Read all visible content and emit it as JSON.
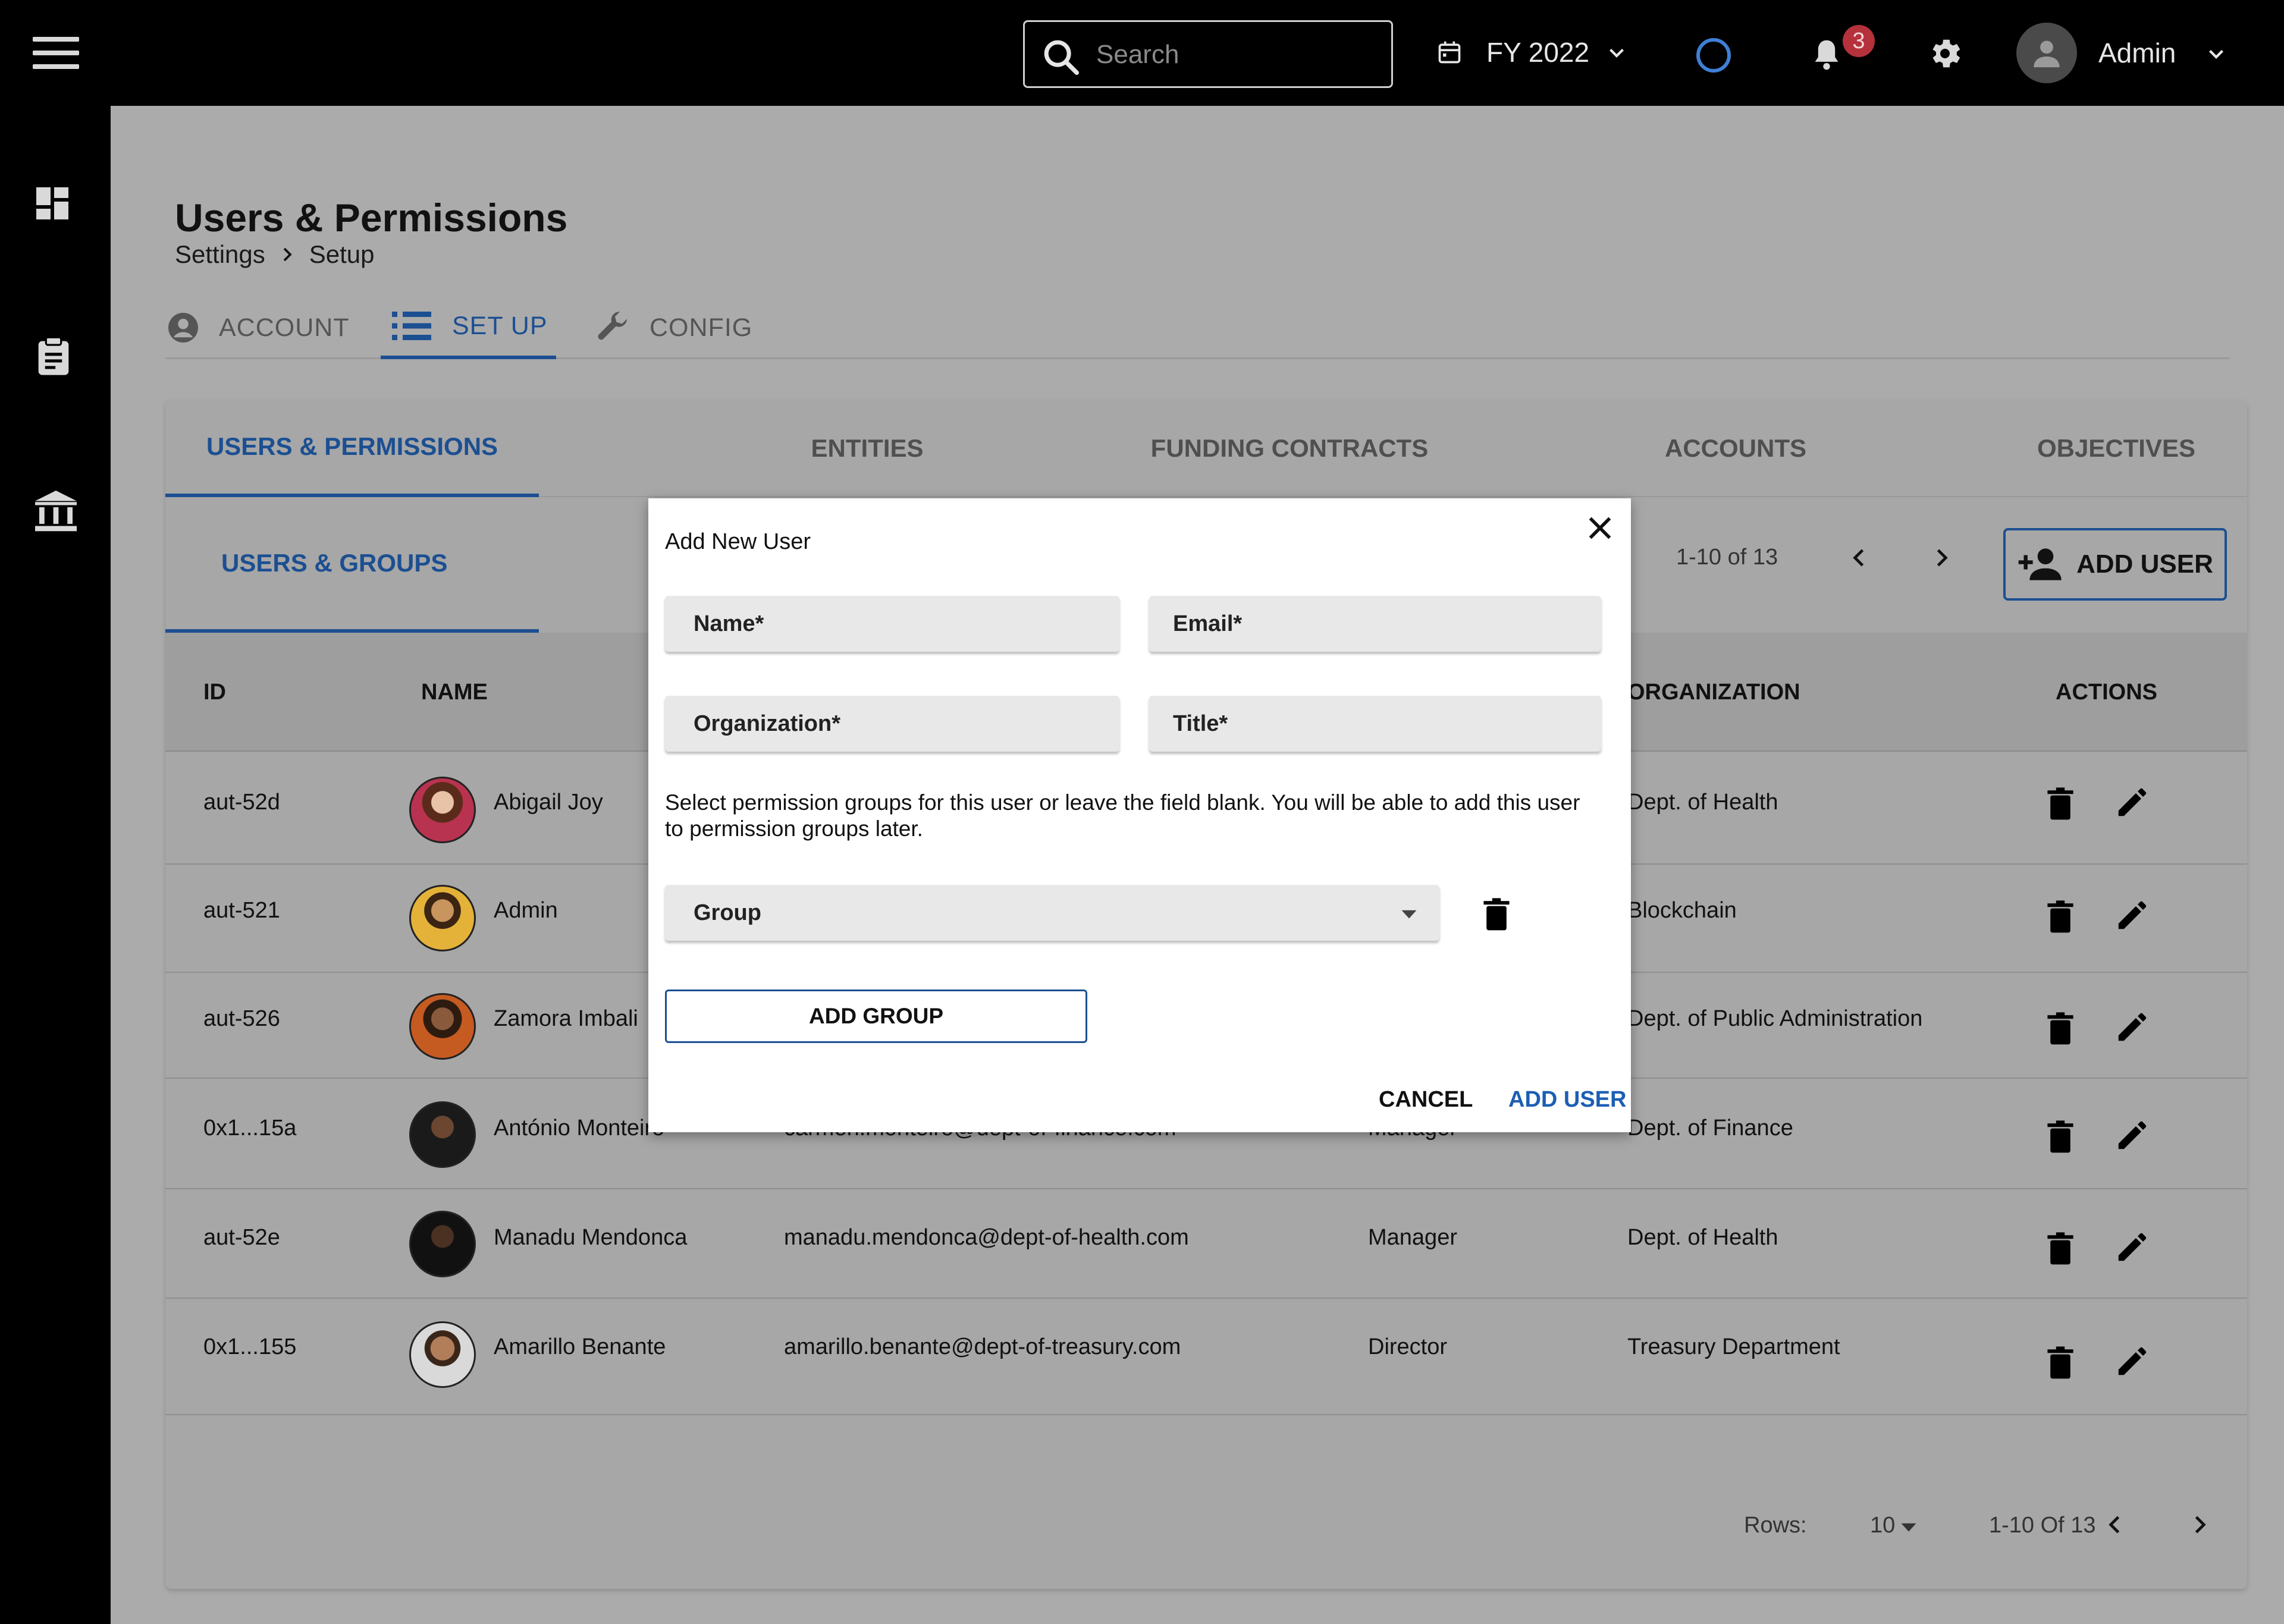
{
  "topbar": {
    "search_placeholder": "Search",
    "fiscal_year": "FY 2022",
    "notification_count": "3",
    "user_name": "Admin"
  },
  "page": {
    "title": "Users & Permissions",
    "breadcrumb": [
      "Settings",
      "Setup"
    ]
  },
  "main_tabs": [
    {
      "label": "ACCOUNT",
      "icon": "account-circle-icon",
      "active": false
    },
    {
      "label": "SET UP",
      "icon": "list-icon",
      "active": true
    },
    {
      "label": "CONFIG",
      "icon": "wrench-icon",
      "active": false
    }
  ],
  "section_tabs": [
    {
      "label": "USERS & PERMISSIONS",
      "active": true
    },
    {
      "label": "ENTITIES",
      "active": false
    },
    {
      "label": "FUNDING CONTRACTS",
      "active": false
    },
    {
      "label": "ACCOUNTS",
      "active": false
    },
    {
      "label": "OBJECTIVES",
      "active": false
    }
  ],
  "subtab": "USERS & GROUPS",
  "pagination_top": {
    "range": "1-10 of 13"
  },
  "add_user_label": "ADD USER",
  "table": {
    "columns": [
      "ID",
      "NAME",
      "ORGANIZATION",
      "ACTIONS"
    ],
    "rows": [
      {
        "id": "aut-52d",
        "name": "Abigail Joy",
        "email": "",
        "title": "",
        "organization": "Dept. of Health"
      },
      {
        "id": "aut-521",
        "name": "Admin",
        "email": "",
        "title": "",
        "organization": "Blockchain"
      },
      {
        "id": "aut-526",
        "name": "Zamora Imbali",
        "email": "",
        "title": "",
        "organization": "Dept. of Public Administration"
      },
      {
        "id": "0x1...15a",
        "name": "António Monteiro",
        "email": "carmen.monteiro@dept-of-finance.com",
        "title": "Manager",
        "organization": "Dept. of Finance"
      },
      {
        "id": "aut-52e",
        "name": "Manadu Mendonca",
        "email": "manadu.mendonca@dept-of-health.com",
        "title": "Manager",
        "organization": "Dept. of Health"
      },
      {
        "id": "0x1...155",
        "name": "Amarillo Benante",
        "email": "amarillo.benante@dept-of-treasury.com",
        "title": "Director",
        "organization": "Treasury Department"
      }
    ]
  },
  "footer": {
    "rows_label": "Rows:",
    "rows_value": "10",
    "range": "1-10 Of 13"
  },
  "modal": {
    "title": "Add New User",
    "name_placeholder": "Name*",
    "email_placeholder": "Email*",
    "organization_placeholder": "Organization*",
    "title_placeholder": "Title*",
    "help_text": "Select permission groups for this user or leave the field blank. You will be able to add this user to permission groups later.",
    "group_select": "Group",
    "add_group_label": "ADD GROUP",
    "cancel_label": "CANCEL",
    "add_user_label": "ADD USER"
  },
  "colors": {
    "accent": "#1c4f92",
    "overlay_bg": "#ababab",
    "badge": "#b5313c"
  }
}
